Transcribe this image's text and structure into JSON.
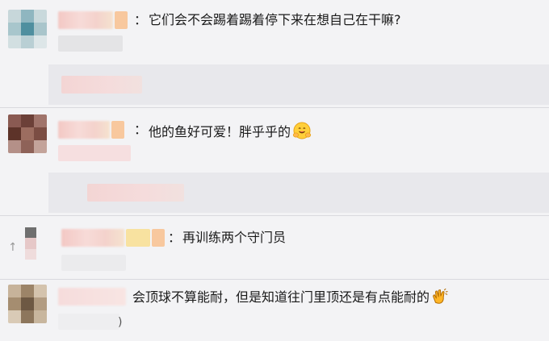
{
  "comments": [
    {
      "text": "它们会不会踢着踢着停下来在想自己在干嘛?",
      "colon": "："
    },
    {
      "text": "他的鱼好可爱！胖乎乎的",
      "colon": "：",
      "emoji": "hugging-face"
    },
    {
      "text": "再训练两个守门员",
      "colon": "："
    },
    {
      "text": "会顶球不算能耐，但是知道往门里顶还是有点能耐的",
      "emoji": "clapping-hands"
    }
  ],
  "partial_text": {
    "left_glyph": "↑",
    "bottom_glyph": ")"
  },
  "colors": {
    "background": "#f3f3f5",
    "reply_strip": "#e8e8ec",
    "separator": "#d9d9de",
    "text": "#1a1a1a"
  }
}
